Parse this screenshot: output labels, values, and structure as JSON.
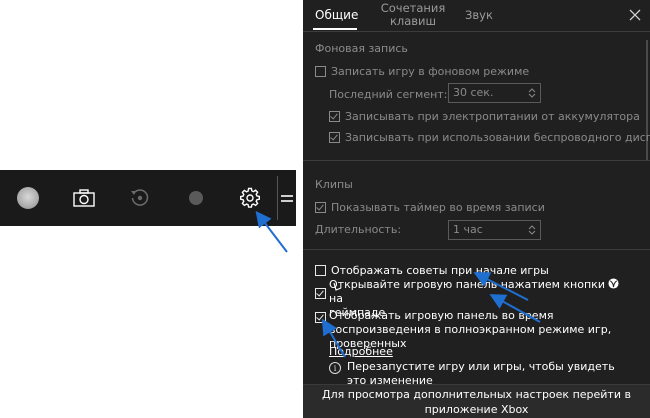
{
  "gamebar": {
    "buttons": [
      {
        "name": "xbox-button",
        "icon": "xbox-disc-icon"
      },
      {
        "name": "screenshot-button",
        "icon": "camera-icon"
      },
      {
        "name": "record-last-button",
        "icon": "history-icon"
      },
      {
        "name": "record-button",
        "icon": "record-dot-icon"
      },
      {
        "name": "settings-button",
        "icon": "gear-icon"
      }
    ]
  },
  "panel": {
    "tabs": {
      "general": "Общие",
      "shortcuts_line1": "Сочетания",
      "shortcuts_line2": "клавиш",
      "sound": "Звук"
    },
    "background_recording": {
      "title": "Фоновая запись",
      "record_in_background": "Записать игру в фоновом режиме",
      "last_segment_label": "Последний сегмент:",
      "last_segment_value": "30 сек.",
      "record_on_battery": "Записывать при электропитании от аккумулятора",
      "record_wireless_display": "Записывать при использовании беспроводного дисплея"
    },
    "clips": {
      "title": "Клипы",
      "show_timer": "Показывать таймер во время записи",
      "duration_label": "Длительность:",
      "duration_value": "1 час"
    },
    "general_options": {
      "show_tips": "Отображать советы при начале игры",
      "open_with_gamepad_1": "Открывайте игровую панель нажатием кнопки",
      "open_with_gamepad_2": "на",
      "open_with_gamepad_3": "геймпаде",
      "show_fullscreen": "Отображать игровую панель во время воспроизведения в полноэкранном режиме игр, проверенных",
      "learn_more": "Подробнее",
      "restart_notice": "Перезапустите игру или игры, чтобы увидеть это изменение"
    },
    "footer": "Для просмотра дополнительных настроек перейти в приложение Xbox"
  },
  "colors": {
    "panel_bg": "#202020",
    "gamebar_bg": "#1a1a1a",
    "arrow_blue": "#1f6fd1"
  }
}
